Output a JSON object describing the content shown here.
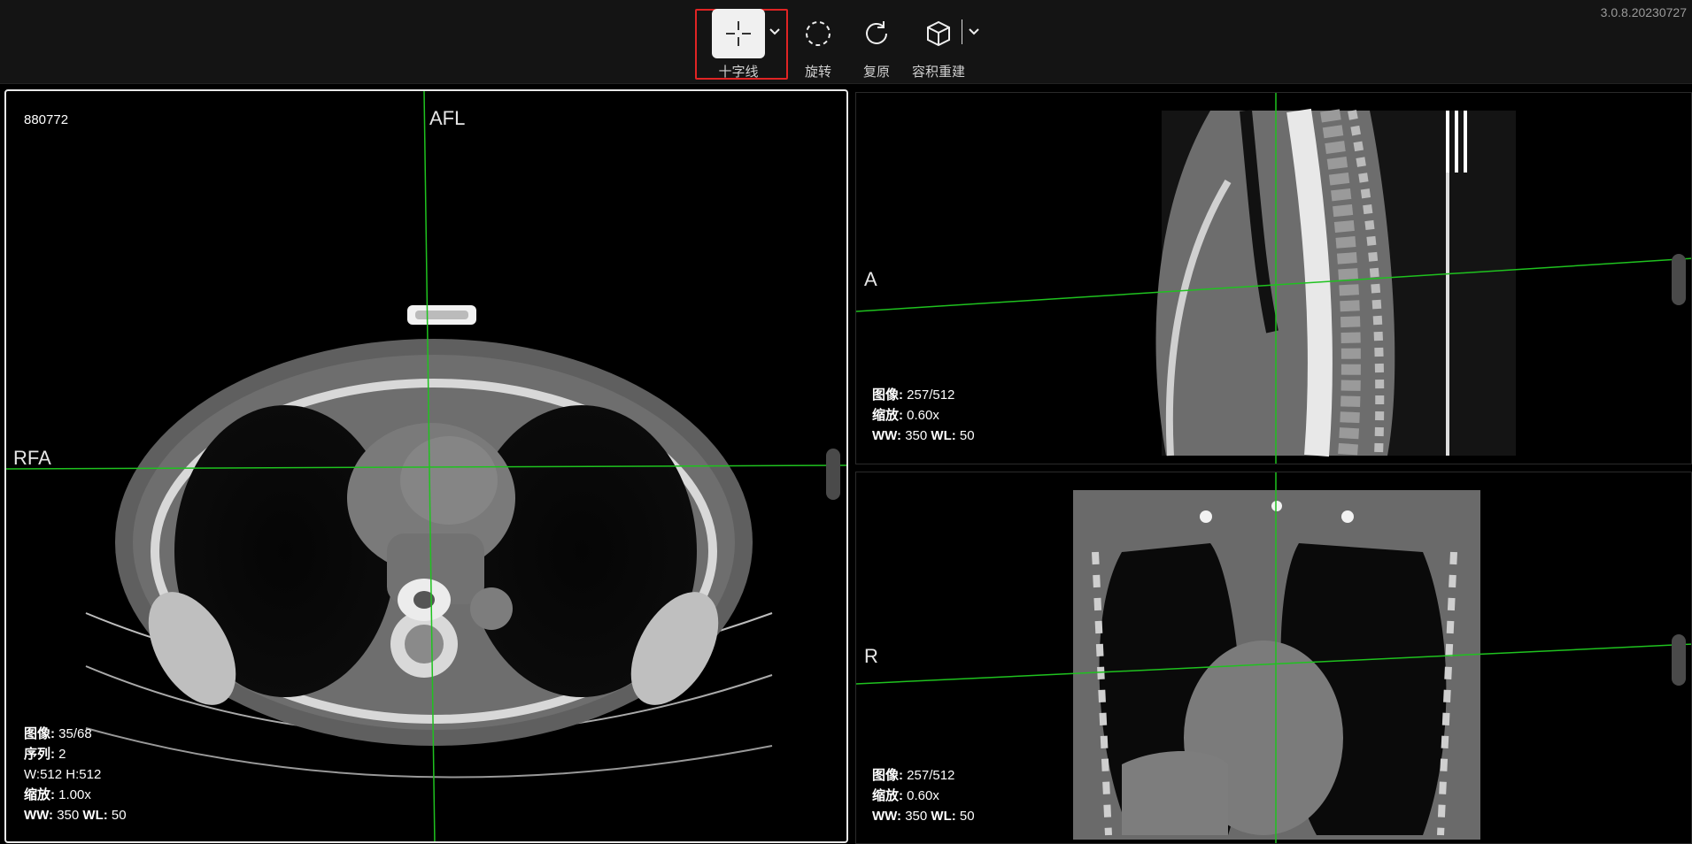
{
  "version": "3.0.8.20230727",
  "toolbar": {
    "tools": [
      {
        "label": "十字线",
        "icon": "crosshair-icon",
        "active": true
      },
      {
        "label": "旋转",
        "icon": "rotate-dashed-circle-icon"
      },
      {
        "label": "复原",
        "icon": "reset-icon"
      },
      {
        "label": "容积重建",
        "icon": "cube-icon"
      }
    ]
  },
  "axial": {
    "patient_id": "880772",
    "orient_top": "AFL",
    "orient_left": "RFA",
    "image_label": "图像:",
    "image_value": "35/68",
    "series_label": "序列:",
    "series_value": "2",
    "w_label": "W:",
    "w_value": "512",
    "h_label": "H:",
    "h_value": "512",
    "zoom_label": "缩放:",
    "zoom_value": "1.00x",
    "ww_label": "WW:",
    "ww_value": "350",
    "wl_label": "WL:",
    "wl_value": "50"
  },
  "sagittal": {
    "orient_left": "A",
    "image_label": "图像:",
    "image_value": "257/512",
    "zoom_label": "缩放:",
    "zoom_value": "0.60x",
    "ww_label": "WW:",
    "ww_value": "350",
    "wl_label": "WL:",
    "wl_value": "50"
  },
  "coronal": {
    "orient_left": "R",
    "image_label": "图像:",
    "image_value": "257/512",
    "zoom_label": "缩放:",
    "zoom_value": "0.60x",
    "ww_label": "WW:",
    "ww_value": "350",
    "wl_label": "WL:",
    "wl_value": "50"
  },
  "colors": {
    "crosshair": "#1fc21f",
    "highlight": "#e02424",
    "toolbar_bg": "#141414"
  }
}
